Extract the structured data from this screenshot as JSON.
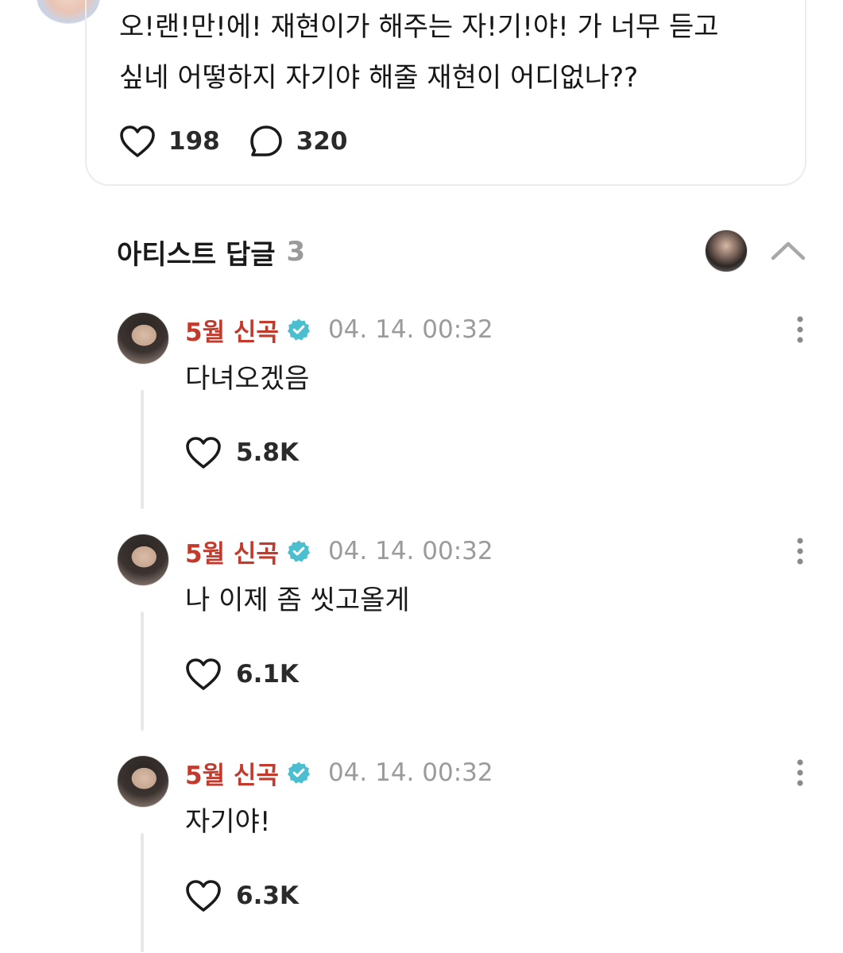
{
  "post": {
    "text": "오!랜!만!에! 재현이가 해주는 자!기!야! 가 너무 듣고\n싶네 어떻하지 자기야 해줄 재현이 어디없나??",
    "likes": "198",
    "comments": "320"
  },
  "artist_replies": {
    "title": "아티스트 답글",
    "count": "3"
  },
  "replies": [
    {
      "author": "5월 신곡",
      "time": "04. 14. 00:32",
      "text": "다녀오겠음",
      "likes": "5.8K"
    },
    {
      "author": "5월 신곡",
      "time": "04. 14. 00:32",
      "text": "나 이제 좀 씻고올게",
      "likes": "6.1K"
    },
    {
      "author": "5월 신곡",
      "time": "04. 14. 00:32",
      "text": "자기야!",
      "likes": "6.3K"
    }
  ],
  "colors": {
    "author": "#c23a2b",
    "verified": "#4bbfd0",
    "muted": "#9b9b9b"
  },
  "icons": {
    "like": "heart-icon",
    "comment": "comment-bubble-icon",
    "verified": "verified-badge-icon",
    "more": "more-vertical-icon",
    "collapse": "chevron-up-icon"
  }
}
